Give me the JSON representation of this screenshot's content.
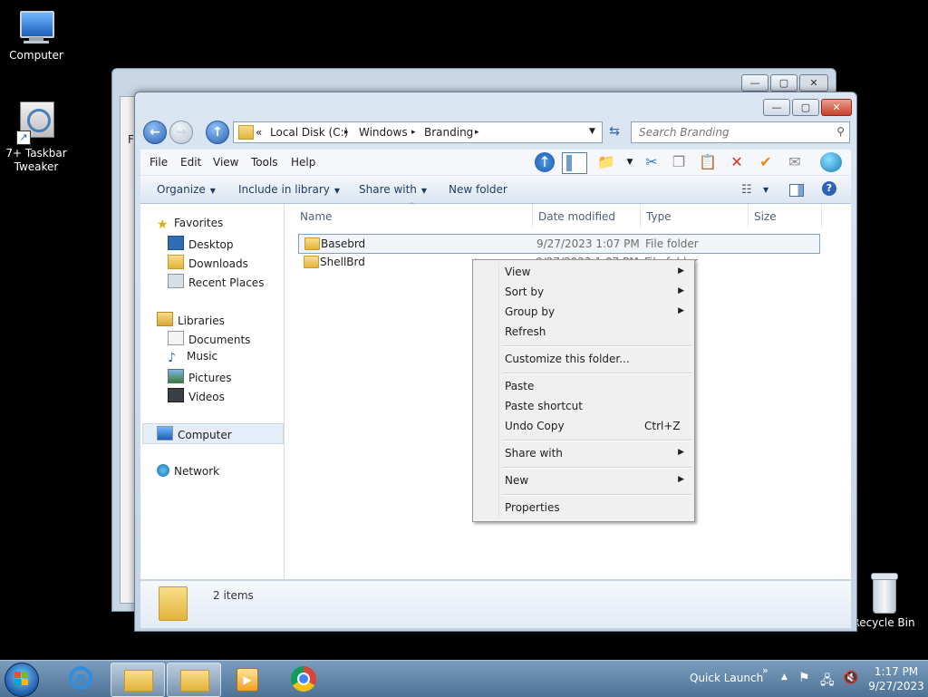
{
  "desktop": {
    "icons": [
      {
        "label": "Computer",
        "icon": "computer-icon"
      },
      {
        "label": "7+ Taskbar Tweaker",
        "icon": "taskbar-tweaker-icon"
      },
      {
        "label": "Recycle Bin",
        "icon": "recycle-bin-icon"
      }
    ]
  },
  "background_window": {
    "partial_label": "F"
  },
  "explorer": {
    "caption": {
      "minimize": "—",
      "maximize": "▢",
      "close": "✕"
    },
    "address": {
      "overflow": "«",
      "crumbs": [
        "Local Disk (C:)",
        "Windows",
        "Branding"
      ],
      "separator": "▸"
    },
    "search": {
      "placeholder": "Search Branding"
    },
    "menu": [
      "File",
      "Edit",
      "View",
      "Tools",
      "Help"
    ],
    "commands": {
      "organize": "Organize",
      "include": "Include in library",
      "share": "Share with",
      "new_folder": "New folder"
    },
    "navpane": {
      "favorites": "Favorites",
      "desktop": "Desktop",
      "downloads": "Downloads",
      "recent": "Recent Places",
      "libraries": "Libraries",
      "documents": "Documents",
      "music": "Music",
      "pictures": "Pictures",
      "videos": "Videos",
      "computer": "Computer",
      "network": "Network"
    },
    "columns": {
      "name": "Name",
      "date": "Date modified",
      "type": "Type",
      "size": "Size"
    },
    "files": [
      {
        "name": "Basebrd",
        "date": "9/27/2023 1:07 PM",
        "type": "File folder"
      },
      {
        "name": "ShellBrd",
        "date": "9/27/2023 1:07 PM",
        "type": "File folder"
      }
    ],
    "status": {
      "count": "2 items"
    }
  },
  "context_menu": {
    "items": [
      {
        "label": "View",
        "submenu": true
      },
      {
        "label": "Sort by",
        "submenu": true
      },
      {
        "label": "Group by",
        "submenu": true
      },
      {
        "label": "Refresh"
      },
      {
        "label": "Customize this folder..."
      },
      {
        "label": "Paste"
      },
      {
        "label": "Paste shortcut"
      },
      {
        "label": "Undo Copy",
        "shortcut": "Ctrl+Z"
      },
      {
        "label": "Share with",
        "submenu": true
      },
      {
        "label": "New",
        "submenu": true
      },
      {
        "label": "Properties"
      }
    ]
  },
  "taskbar": {
    "quick_launch": "Quick Launch",
    "chevron": "»",
    "time": "1:17 PM",
    "date": "9/27/2023"
  }
}
